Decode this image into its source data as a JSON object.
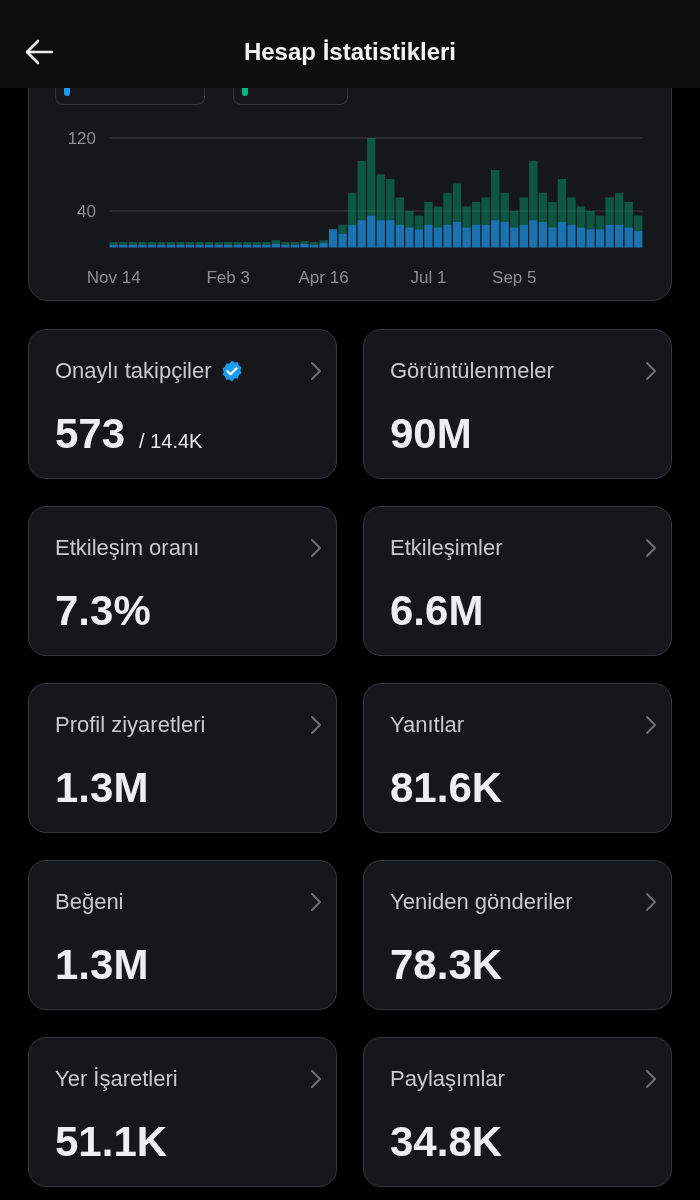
{
  "header": {
    "title": "Hesap İstatistikleri"
  },
  "chart": {
    "chart_data": {
      "type": "bar",
      "stacked": true,
      "categories": [
        "Nov 14",
        null,
        null,
        null,
        null,
        null,
        null,
        null,
        null,
        null,
        null,
        null,
        "Feb 3",
        null,
        null,
        null,
        null,
        null,
        null,
        null,
        null,
        null,
        "Apr 16",
        null,
        null,
        null,
        null,
        null,
        null,
        null,
        null,
        null,
        null,
        "Jul 1",
        null,
        null,
        null,
        null,
        null,
        null,
        null,
        null,
        "Sep 5",
        null,
        null,
        null,
        null,
        null,
        null,
        null,
        null,
        null,
        null,
        null,
        null,
        null
      ],
      "series": [
        {
          "color": "#1d9bf0",
          "values": [
            3,
            3,
            3,
            3,
            3,
            3,
            3,
            3,
            3,
            3,
            3,
            3,
            3,
            3,
            3,
            3,
            3,
            4,
            3,
            3,
            4,
            3,
            5,
            20,
            15,
            25,
            30,
            35,
            30,
            30,
            25,
            22,
            20,
            25,
            22,
            25,
            28,
            22,
            25,
            25,
            30,
            28,
            22,
            25,
            30,
            28,
            22,
            28,
            25,
            22,
            20,
            20,
            25,
            25,
            22,
            18
          ]
        },
        {
          "color": "#00ba7c",
          "values": [
            3,
            3,
            3,
            3,
            3,
            3,
            3,
            3,
            3,
            3,
            3,
            3,
            3,
            3,
            3,
            3,
            3,
            4,
            3,
            3,
            3,
            3,
            3,
            0,
            10,
            35,
            65,
            85,
            50,
            45,
            30,
            18,
            15,
            25,
            23,
            35,
            42,
            23,
            25,
            30,
            55,
            32,
            18,
            30,
            65,
            32,
            28,
            47,
            30,
            23,
            20,
            15,
            30,
            35,
            28,
            17
          ]
        }
      ],
      "ylim": [
        0,
        120
      ],
      "yticks": [
        40,
        120
      ]
    }
  },
  "stats": [
    {
      "label": "Onaylı takipçiler",
      "verified": true,
      "value": "573",
      "suffix": "/ 14.4K"
    },
    {
      "label": "Görüntülenmeler",
      "verified": false,
      "value": "90M"
    },
    {
      "label": "Etkileşim oranı",
      "verified": false,
      "value": "7.3%"
    },
    {
      "label": "Etkileşimler",
      "verified": false,
      "value": "6.6M"
    },
    {
      "label": "Profil ziyaretleri",
      "verified": false,
      "value": "1.3M"
    },
    {
      "label": "Yanıtlar",
      "verified": false,
      "value": "81.6K"
    },
    {
      "label": "Beğeni",
      "verified": false,
      "value": "1.3M"
    },
    {
      "label": "Yeniden gönderiler",
      "verified": false,
      "value": "78.3K"
    },
    {
      "label": "Yer İşaretleri",
      "verified": false,
      "value": "51.1K"
    },
    {
      "label": "Paylaşımlar",
      "verified": false,
      "value": "34.8K"
    }
  ]
}
